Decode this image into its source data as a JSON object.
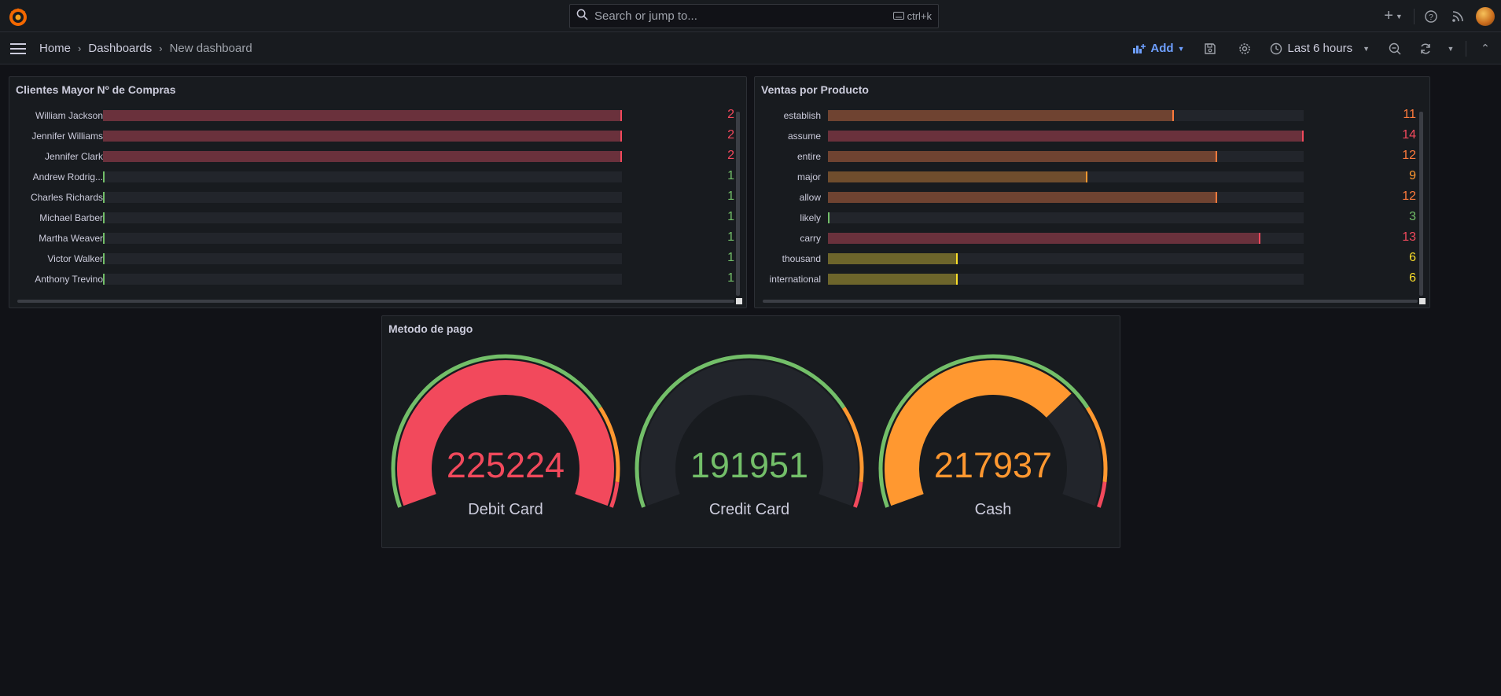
{
  "search": {
    "placeholder": "Search or jump to...",
    "shortcut": "ctrl+k"
  },
  "breadcrumb": {
    "home": "Home",
    "dashboards": "Dashboards",
    "current": "New dashboard"
  },
  "toolbar": {
    "add_label": "Add",
    "time_range": "Last 6 hours"
  },
  "colors": {
    "red": "#f2495c",
    "orange": "#ff9830",
    "yellow": "#fade2a",
    "green": "#73bf69"
  },
  "panels": {
    "clientes": {
      "title": "Clientes Mayor Nº de Compras",
      "max": 2,
      "rows": [
        {
          "label": "William Jackson",
          "value": "2"
        },
        {
          "label": "Jennifer Williams",
          "value": "2"
        },
        {
          "label": "Jennifer Clark",
          "value": "2"
        },
        {
          "label": "Andrew Rodrig...",
          "value": "1"
        },
        {
          "label": "Charles Richards",
          "value": "1"
        },
        {
          "label": "Michael Barber",
          "value": "1"
        },
        {
          "label": "Martha Weaver",
          "value": "1"
        },
        {
          "label": "Victor Walker",
          "value": "1"
        },
        {
          "label": "Anthony Trevino",
          "value": "1"
        }
      ]
    },
    "ventas": {
      "title": "Ventas por Producto",
      "min": 3,
      "max": 14,
      "rows": [
        {
          "label": "establish",
          "value": "11"
        },
        {
          "label": "assume",
          "value": "14"
        },
        {
          "label": "entire",
          "value": "12"
        },
        {
          "label": "major",
          "value": "9"
        },
        {
          "label": "allow",
          "value": "12"
        },
        {
          "label": "likely",
          "value": "3"
        },
        {
          "label": "carry",
          "value": "13"
        },
        {
          "label": "thousand",
          "value": "6"
        },
        {
          "label": "international",
          "value": "6"
        }
      ]
    },
    "metodo": {
      "title": "Metodo de pago",
      "gauges": [
        {
          "label": "Debit Card",
          "value": "225224",
          "fraction": 1.0,
          "color": "#f2495c"
        },
        {
          "label": "Credit Card",
          "value": "191951",
          "fraction": 0.0,
          "color": "#73bf69"
        },
        {
          "label": "Cash",
          "value": "217937",
          "fraction": 0.71,
          "color": "#ff9830"
        }
      ]
    }
  }
}
